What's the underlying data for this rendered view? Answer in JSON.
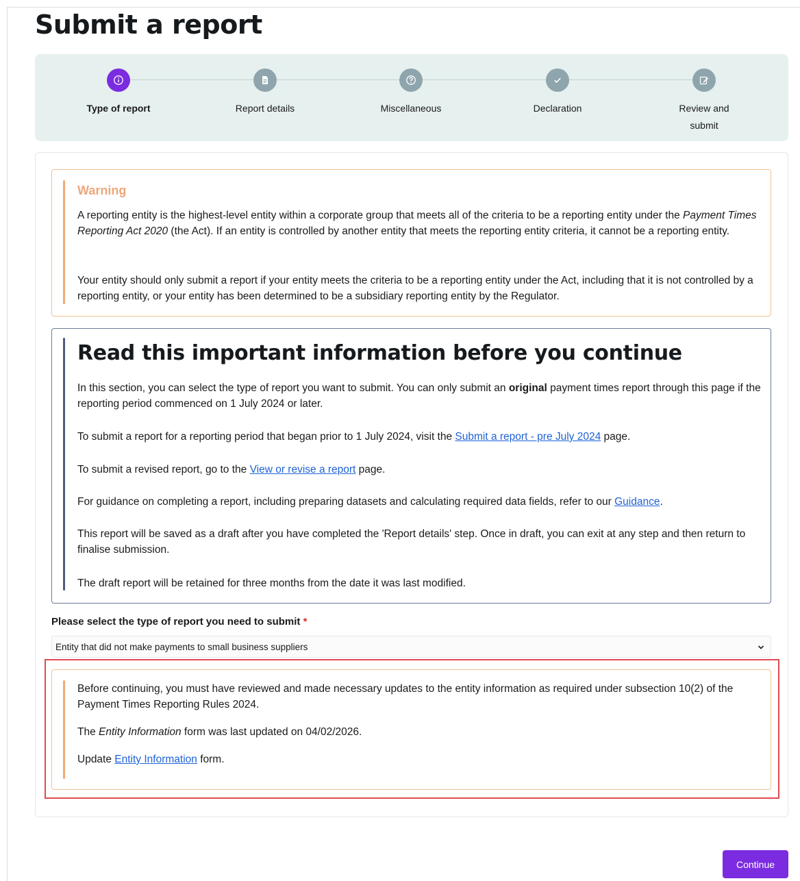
{
  "page": {
    "title": "Submit a report"
  },
  "stepper": {
    "steps": [
      {
        "label": "Type of report",
        "state": "active",
        "icon": "info-icon"
      },
      {
        "label": "Report details",
        "state": "pending",
        "icon": "document-icon"
      },
      {
        "label": "Miscellaneous",
        "state": "pending",
        "icon": "question-icon"
      },
      {
        "label": "Declaration",
        "state": "pending",
        "icon": "check-icon"
      },
      {
        "label_line1": "Review and",
        "label_line2": "submit",
        "state": "pending",
        "icon": "edit-icon"
      }
    ]
  },
  "warning": {
    "title": "Warning",
    "p1_before": "A reporting entity is the highest-level entity within a corporate group that meets all of the criteria to be a reporting entity under the ",
    "p1_italic": "Payment Times Reporting Act 2020",
    "p1_after": " (the Act). If an entity is controlled by another entity that meets the reporting entity criteria, it cannot be a reporting entity.",
    "p2": "Your entity should only submit a report if your entity meets the criteria to be a reporting entity under the Act, including that it is not controlled by a reporting entity, or your entity has been determined to be a subsidiary reporting entity by the Regulator."
  },
  "info": {
    "title": "Read this important information before you continue",
    "p1_before": "In this section, you can select the type of report you want to submit. You can only submit an ",
    "p1_bold": "original",
    "p1_after": " payment times report through this page if the reporting period commenced on 1 July 2024 or later.",
    "p2_before": "To submit a report for a reporting period that began prior to 1 July 2024, visit the ",
    "p2_link": "Submit a report - pre July 2024",
    "p2_after": " page.",
    "p3_before": "To submit a revised report, go to the ",
    "p3_link": "View or revise a report",
    "p3_after": " page.",
    "p4_before": "For guidance on completing a report, including preparing datasets and calculating required data fields, refer to our ",
    "p4_link": "Guidance",
    "p4_after": ".",
    "p5": "This report will be saved as a draft after you have completed the 'Report details' step. Once in draft, you can exit at any step and then return to finalise submission.",
    "p6": "The draft report will be retained for three months from the date it was last modified."
  },
  "report_type": {
    "label": "Please select the type of report you need to submit",
    "required_marker": "*",
    "selected": "Entity that did not make payments to small business suppliers"
  },
  "notice": {
    "p1": "Before continuing, you must have reviewed and made necessary updates to the entity information as required under subsection 10(2) of the Payment Times Reporting Rules 2024.",
    "p2_before": "The ",
    "p2_italic": "Entity Information",
    "p2_after": " form was last updated on 04/02/2026.",
    "p3_before": "Update ",
    "p3_link": "Entity Information",
    "p3_after": " form."
  },
  "actions": {
    "continue_label": "Continue"
  },
  "colors": {
    "accent": "#7b2ce0",
    "warning": "#eda77a",
    "link": "#1f62d6",
    "highlight": "#e04a4f"
  }
}
